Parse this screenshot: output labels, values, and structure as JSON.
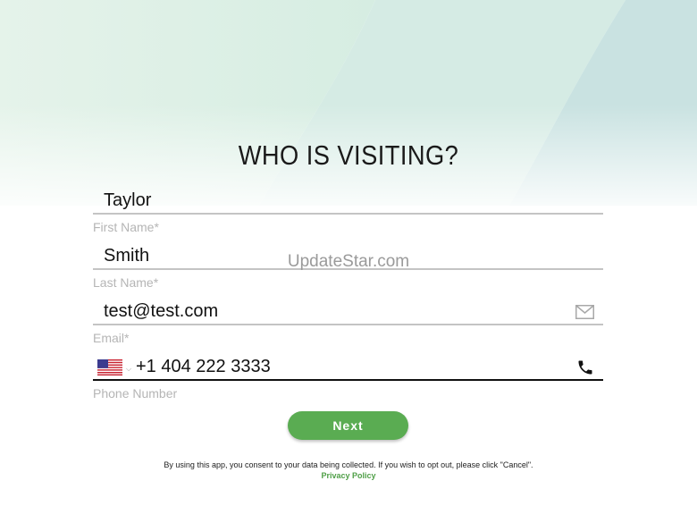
{
  "page": {
    "title": "WHO IS VISITING?"
  },
  "form": {
    "first_name": {
      "value": "Taylor",
      "label": "First Name*"
    },
    "last_name": {
      "value": "Smith",
      "label": "Last Name*"
    },
    "email": {
      "value": "test@test.com",
      "label": "Email*",
      "icon": "mail-icon"
    },
    "phone": {
      "value": "+1 404 222 3333",
      "label": "Phone Number",
      "country_icon": "us-flag-icon",
      "icon": "phone-icon"
    }
  },
  "watermark": "UpdateStar.com",
  "actions": {
    "next_label": "Next"
  },
  "footer": {
    "consent_text": "By using this app, you consent to your data being collected. If you wish to opt out, please click \"Cancel\".",
    "privacy_label": "Privacy Policy"
  },
  "colors": {
    "accent_green": "#5aac52",
    "privacy_green": "#4f9f47",
    "bg_mint": "#dcefe6",
    "bg_teal": "#cfe4e3"
  }
}
